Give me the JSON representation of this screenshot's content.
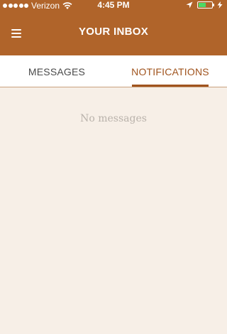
{
  "status_bar": {
    "carrier": "Verizon",
    "time": "4:45 PM",
    "signal_dots": 5,
    "battery_level": 0.55
  },
  "header": {
    "title": "YOUR INBOX",
    "menu_icon": "hamburger-menu-icon"
  },
  "tabs": [
    {
      "label": "MESSAGES",
      "active": false
    },
    {
      "label": "NOTIFICATIONS",
      "active": true
    }
  ],
  "content": {
    "empty_message": "No messages"
  },
  "colors": {
    "brand": "#b0642a",
    "accent": "#a0541e",
    "background": "#f7efe7"
  }
}
